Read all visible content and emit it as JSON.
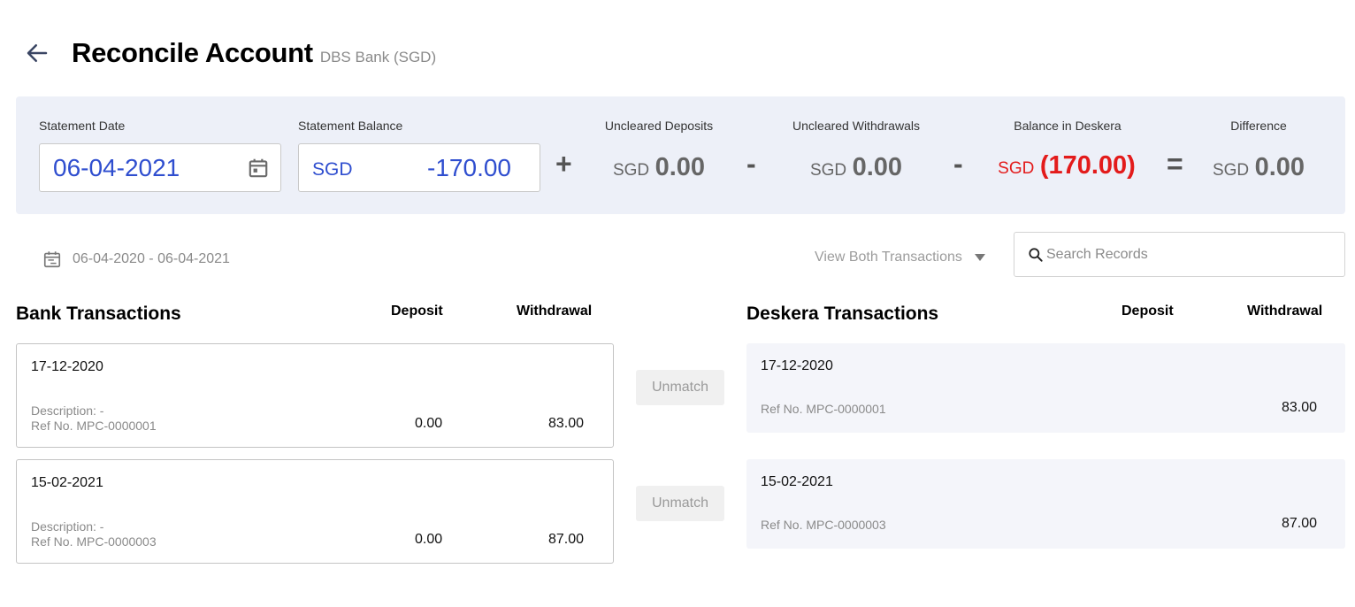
{
  "header": {
    "title": "Reconcile Account",
    "subtitle": "DBS Bank (SGD)"
  },
  "summary": {
    "statement_date_label": "Statement Date",
    "statement_date_value": "06-04-2021",
    "statement_balance_label": "Statement Balance",
    "statement_balance_currency": "SGD",
    "statement_balance_value": "-170.00",
    "uncleared_deposits_label": "Uncleared Deposits",
    "uncleared_deposits_currency": "SGD",
    "uncleared_deposits_value": "0.00",
    "uncleared_withdrawals_label": "Uncleared Withdrawals",
    "uncleared_withdrawals_currency": "SGD",
    "uncleared_withdrawals_value": "0.00",
    "balance_deskera_label": "Balance in Deskera",
    "balance_deskera_currency": "SGD",
    "balance_deskera_value": "(170.00)",
    "difference_label": "Difference",
    "difference_currency": "SGD",
    "difference_value": "0.00",
    "op_plus": "+",
    "op_minus": "-",
    "op_equals": "=",
    "accent_color": "#2f4ecf",
    "negative_color": "#e31b1b"
  },
  "filters": {
    "date_range": "06-04-2020 - 06-04-2021",
    "view_select": "View Both Transactions",
    "search_placeholder": "Search Records"
  },
  "bank": {
    "title": "Bank Transactions",
    "deposit_header": "Deposit",
    "withdrawal_header": "Withdrawal",
    "rows": [
      {
        "date": "17-12-2020",
        "description": "Description: -",
        "ref": "Ref No. MPC-0000001",
        "deposit": "0.00",
        "withdrawal": "83.00"
      },
      {
        "date": "15-02-2021",
        "description": "Description: -",
        "ref": "Ref No. MPC-0000003",
        "deposit": "0.00",
        "withdrawal": "87.00"
      }
    ]
  },
  "unmatch_label": "Unmatch",
  "deskera": {
    "title": "Deskera Transactions",
    "deposit_header": "Deposit",
    "withdrawal_header": "Withdrawal",
    "rows": [
      {
        "date": "17-12-2020",
        "ref": "Ref No. MPC-0000001",
        "withdrawal": "83.00"
      },
      {
        "date": "15-02-2021",
        "ref": "Ref No. MPC-0000003",
        "withdrawal": "87.00"
      }
    ]
  }
}
